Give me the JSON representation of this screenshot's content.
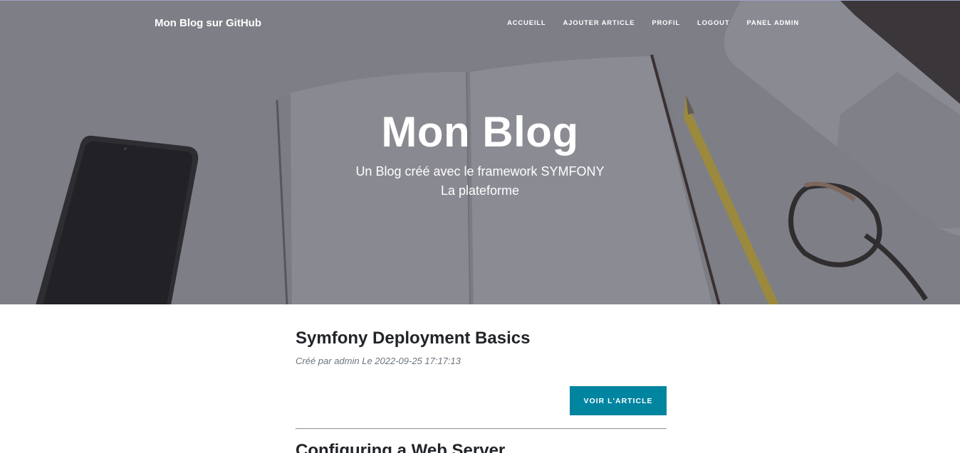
{
  "navbar": {
    "brand": "Mon Blog sur GitHub",
    "links": [
      "ACCUEILL",
      "AJOUTER ARTICLE",
      "PROFIL",
      "LOGOUT",
      "PANEL ADMIN"
    ]
  },
  "hero": {
    "title": "Mon Blog",
    "subtitle_line1": "Un Blog créé avec le framework SYMFONY",
    "subtitle_line2": "La plateforme"
  },
  "posts": [
    {
      "title": "Symfony Deployment Basics",
      "meta": "Créé par admin Le 2022-09-25 17:17:13",
      "button": "VOIR L'ARTICLE"
    },
    {
      "title": "Configuring a Web Server"
    }
  ],
  "colors": {
    "accent": "#0085a1",
    "hero_overlay": "#8e8f96"
  }
}
